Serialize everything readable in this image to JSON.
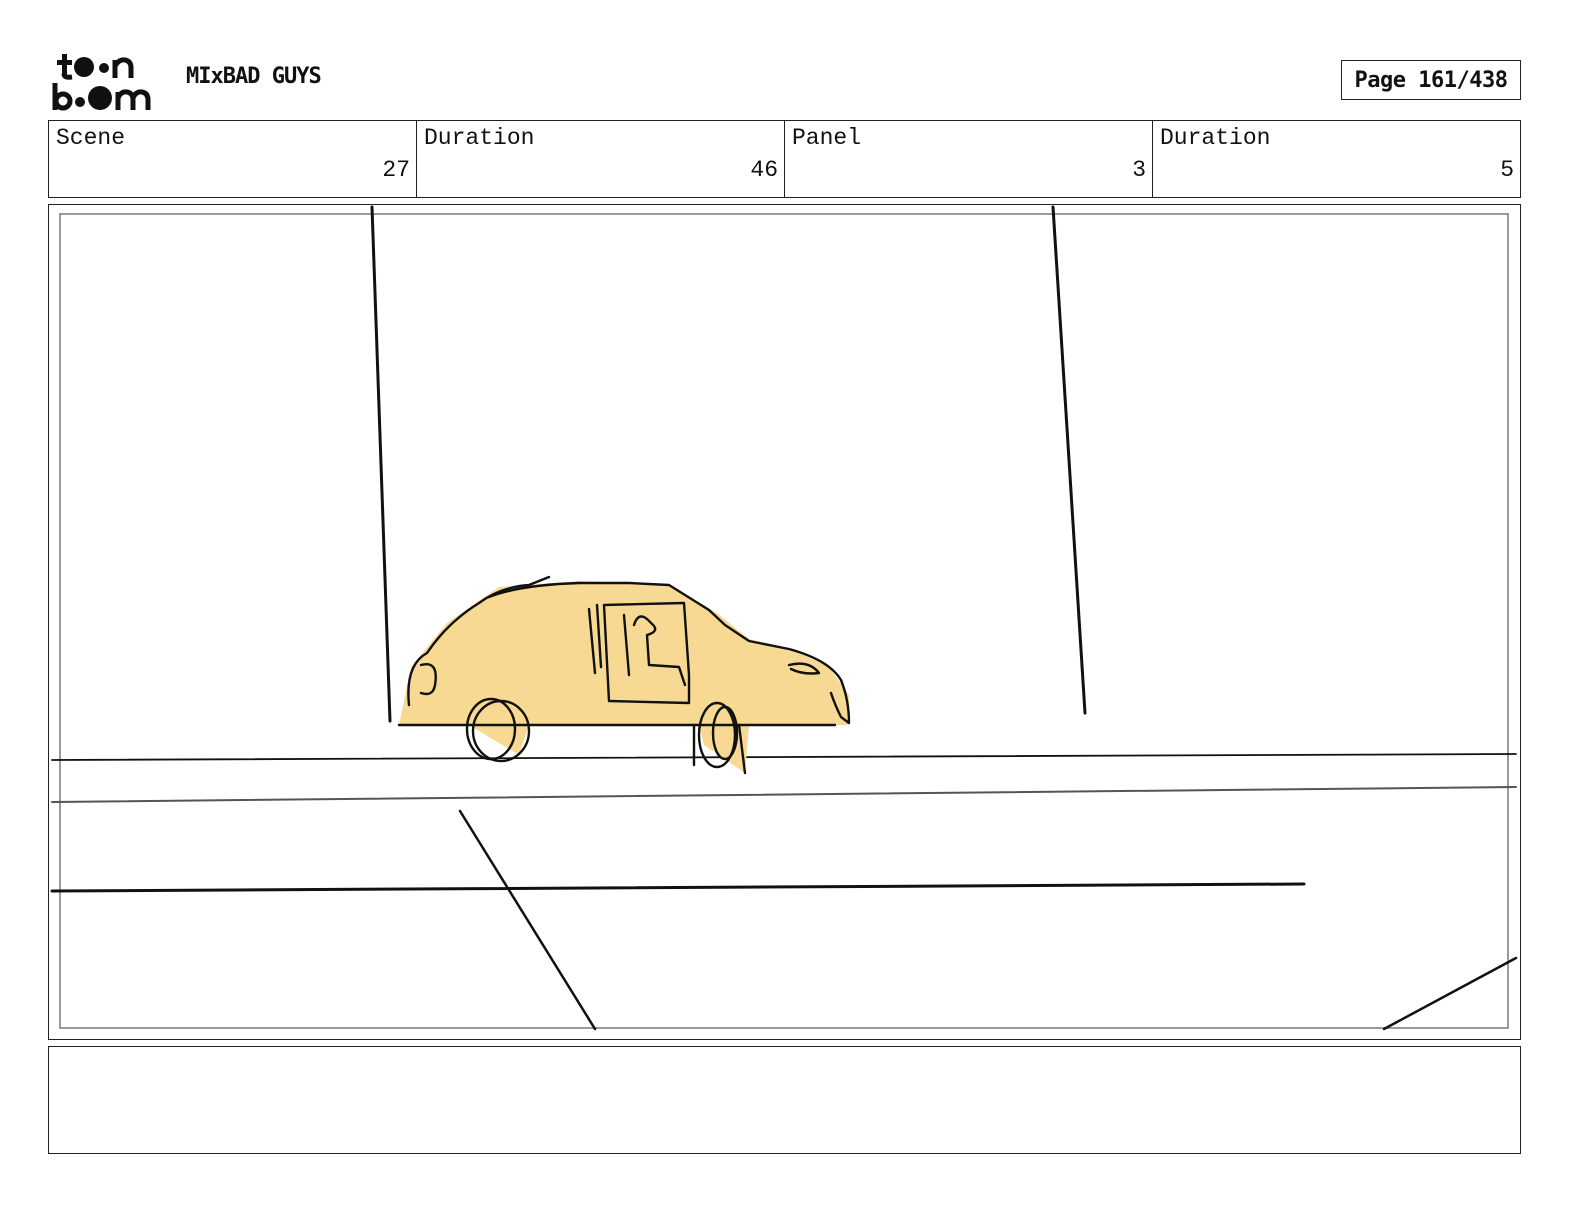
{
  "header": {
    "logo": {
      "icon": "toon-boom-logo-icon",
      "text_line1": "t••n",
      "text_line2": "b••m"
    },
    "project_title": "MIxBAD GUYS",
    "page_label": "Page 161/438"
  },
  "info_bar": {
    "cells": [
      {
        "label": "Scene",
        "value": "27"
      },
      {
        "label": "Duration",
        "value": "46"
      },
      {
        "label": "Panel",
        "value": "3"
      },
      {
        "label": "Duration",
        "value": "5"
      }
    ]
  },
  "panel": {
    "image": "storyboard-sketch-car-on-street",
    "car_fill_color": "#f8d993",
    "line_color": "#111111"
  },
  "notes": {
    "text": ""
  }
}
